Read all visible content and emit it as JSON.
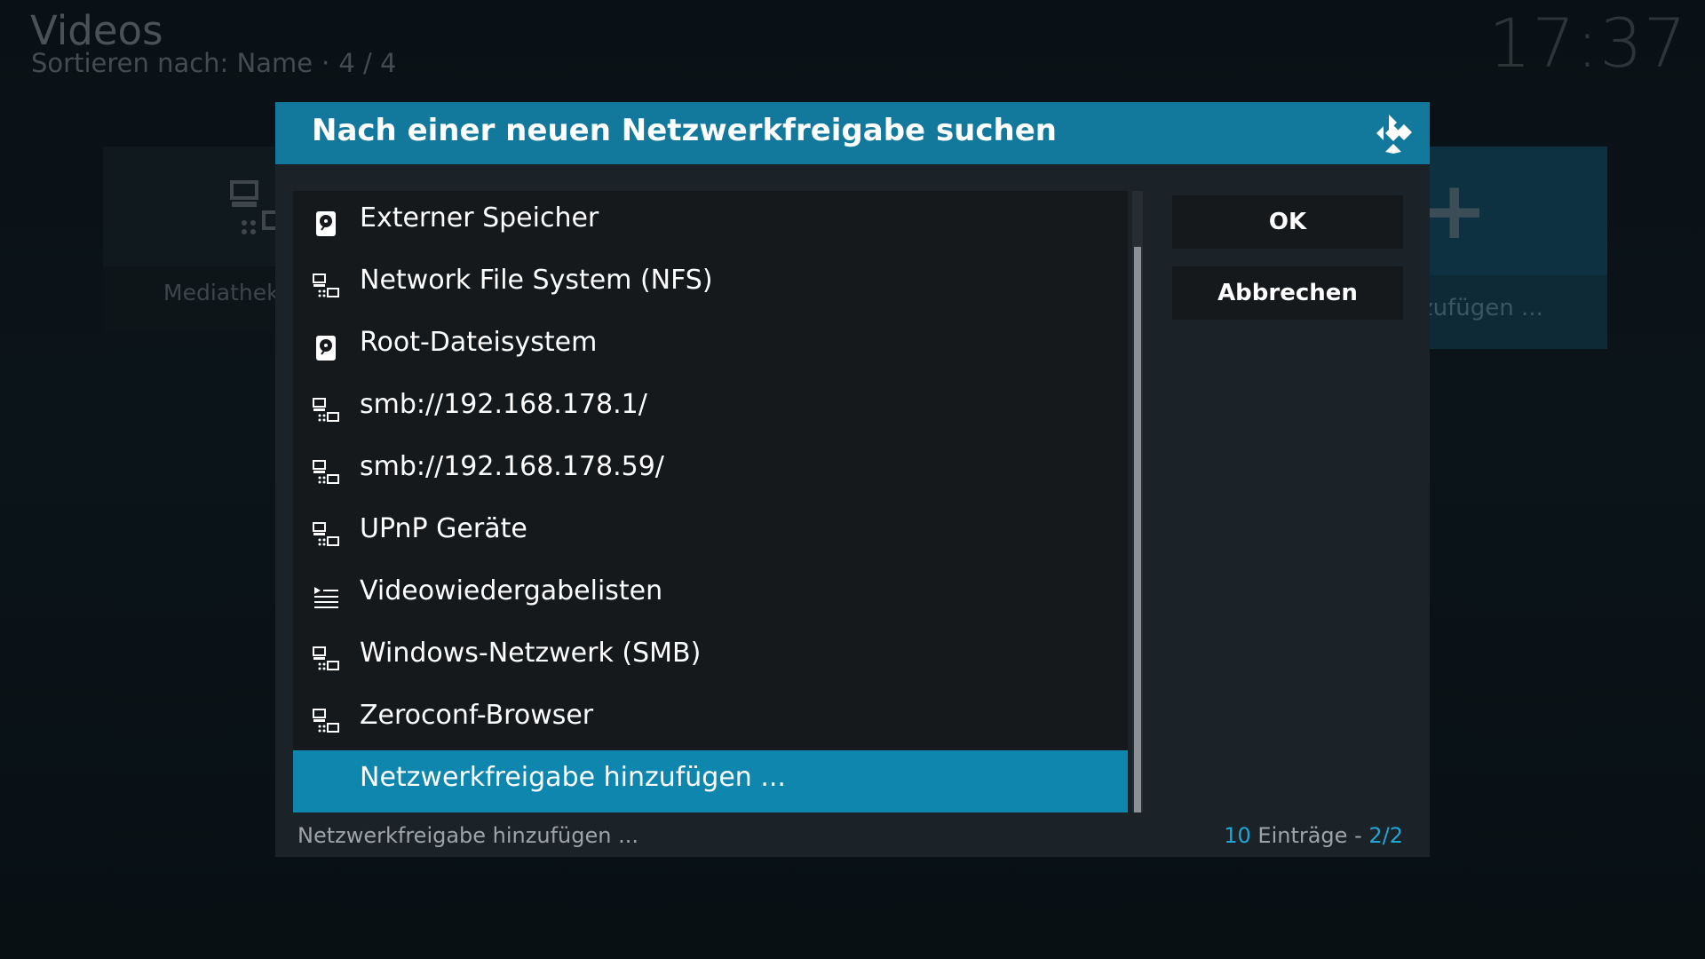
{
  "background": {
    "title": "Videos",
    "sort_label": "Sortieren nach: Name",
    "separator": "·",
    "page_counter": "4 / 4",
    "clock": "17:37",
    "left_card_label": "MediathekV",
    "right_card_label": "zufügen ..."
  },
  "dialog": {
    "title": "Nach einer neuen Netzwerkfreigabe suchen",
    "items": [
      {
        "label": "Externer Speicher",
        "icon": "hard-drive-icon"
      },
      {
        "label": "Network File System (NFS)",
        "icon": "network-icon"
      },
      {
        "label": "Root-Dateisystem",
        "icon": "hard-drive-icon"
      },
      {
        "label": "smb://192.168.178.1/",
        "icon": "network-icon"
      },
      {
        "label": "smb://192.168.178.59/",
        "icon": "network-icon"
      },
      {
        "label": "UPnP Geräte",
        "icon": "network-icon"
      },
      {
        "label": "Videowiedergabelisten",
        "icon": "playlist-icon"
      },
      {
        "label": "Windows-Netzwerk (SMB)",
        "icon": "network-icon"
      },
      {
        "label": "Zeroconf-Browser",
        "icon": "network-icon"
      },
      {
        "label": "Netzwerkfreigabe hinzufügen ...",
        "icon": "",
        "selected": true
      }
    ],
    "ok_label": "OK",
    "cancel_label": "Abbrechen",
    "footer_selected": "Netzwerkfreigabe hinzufügen ...",
    "footer_count": "10",
    "footer_entries_text": "Einträge -",
    "footer_page": "2/2"
  },
  "colors": {
    "accent": "#12789c",
    "selected": "#0f86ad",
    "highlight_text": "#1ea6d6"
  }
}
